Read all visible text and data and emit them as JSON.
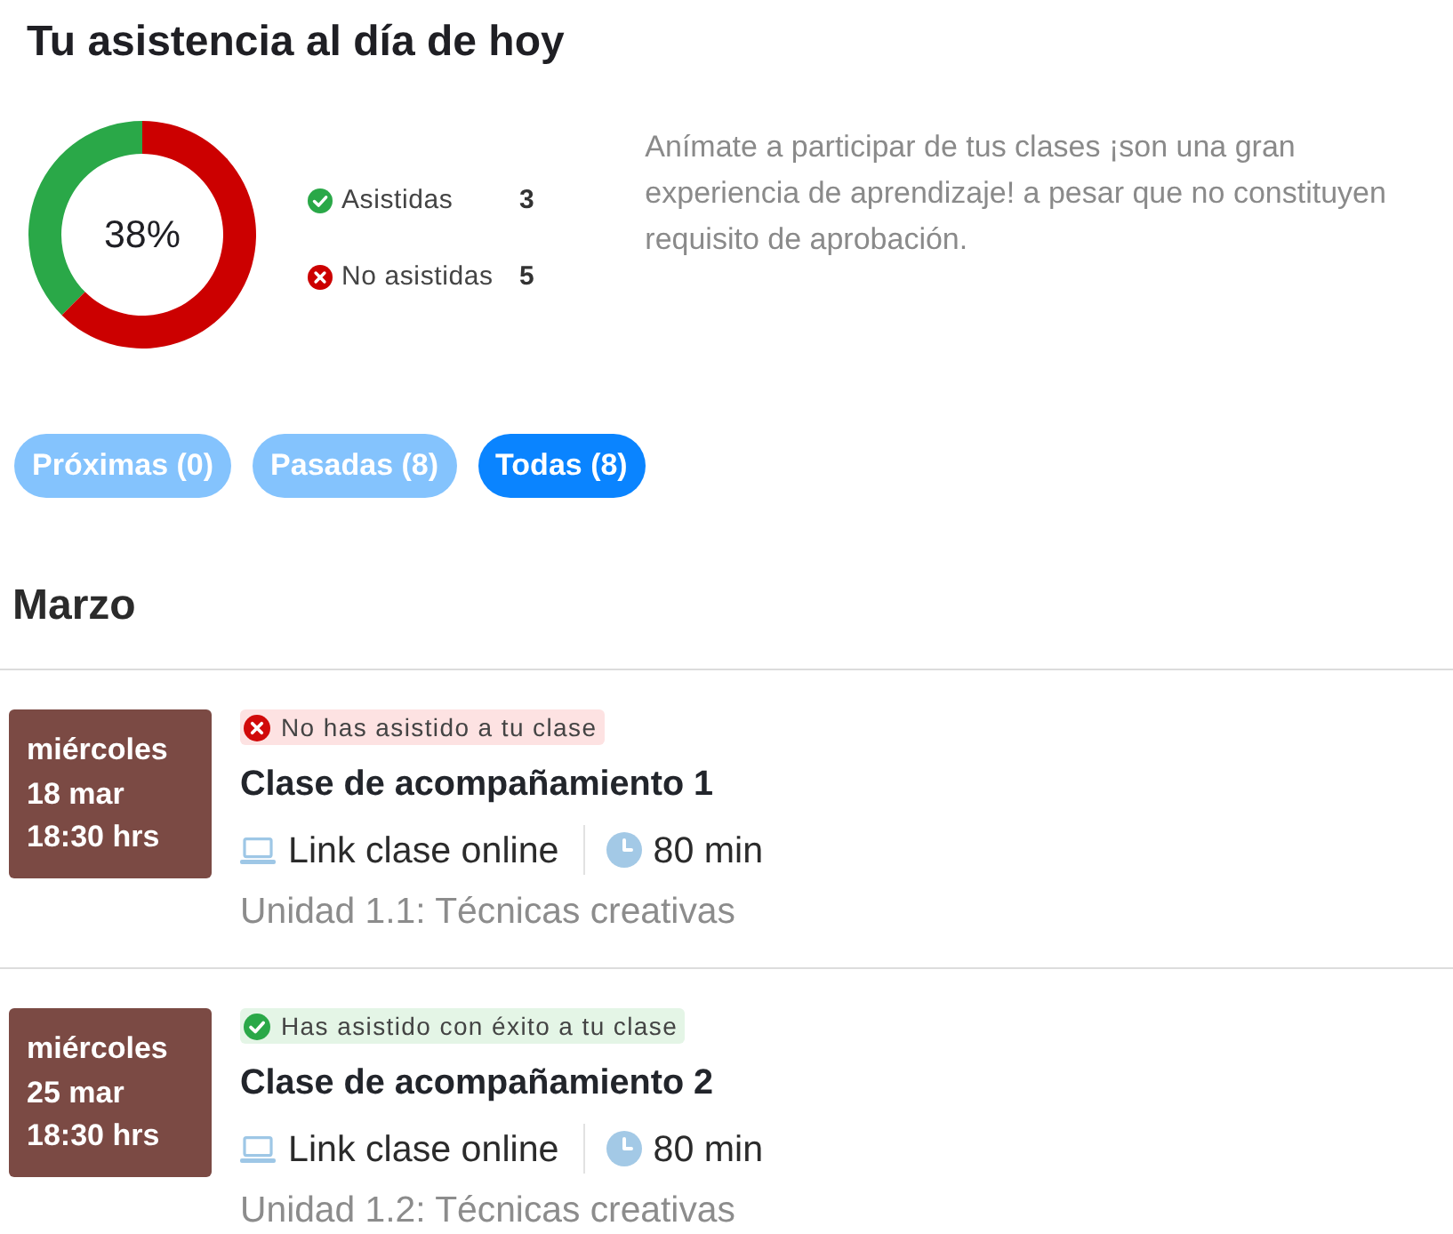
{
  "page": {
    "title": "Tu asistencia al día de hoy"
  },
  "attendance": {
    "chart_data": {
      "type": "donut",
      "categories": [
        "Asistidas",
        "No asistidas"
      ],
      "values": [
        37.5,
        62.5
      ]
    },
    "center_label": "38%",
    "legend": [
      {
        "kind": "attended",
        "color": "#2aa848",
        "count": "3"
      },
      {
        "kind": "missed",
        "color": "#cc0000",
        "count": "5"
      }
    ],
    "note": "Anímate a participar de tus clases ¡son una gran experiencia de aprendizaje! a pesar que no constituyen requisito de aprobación."
  },
  "filters": [
    {
      "label": "Próximas (0)",
      "selected": false
    },
    {
      "label": "Pasadas (8)",
      "selected": false
    },
    {
      "label": "Todas (8)",
      "selected": true
    }
  ],
  "month": "Marzo",
  "classes": [
    {
      "weekday": "miércoles",
      "date": "18 mar",
      "time": "18:30 hrs",
      "status": {
        "kind": "missed",
        "text": "No has asistido a tu clase"
      },
      "title": "Clase de acompañamiento 1",
      "link": "Link clase online",
      "duration": "80 min",
      "unit": "Unidad 1.1: Técnicas creativas"
    },
    {
      "weekday": "miércoles",
      "date": "25 mar",
      "time": "18:30 hrs",
      "status": {
        "kind": "attended",
        "text": "Has asistido con éxito a tu clase"
      },
      "title": "Clase de acompañamiento 2",
      "link": "Link clase online",
      "duration": "80 min",
      "unit": "Unidad 1.2: Técnicas creativas"
    }
  ]
}
